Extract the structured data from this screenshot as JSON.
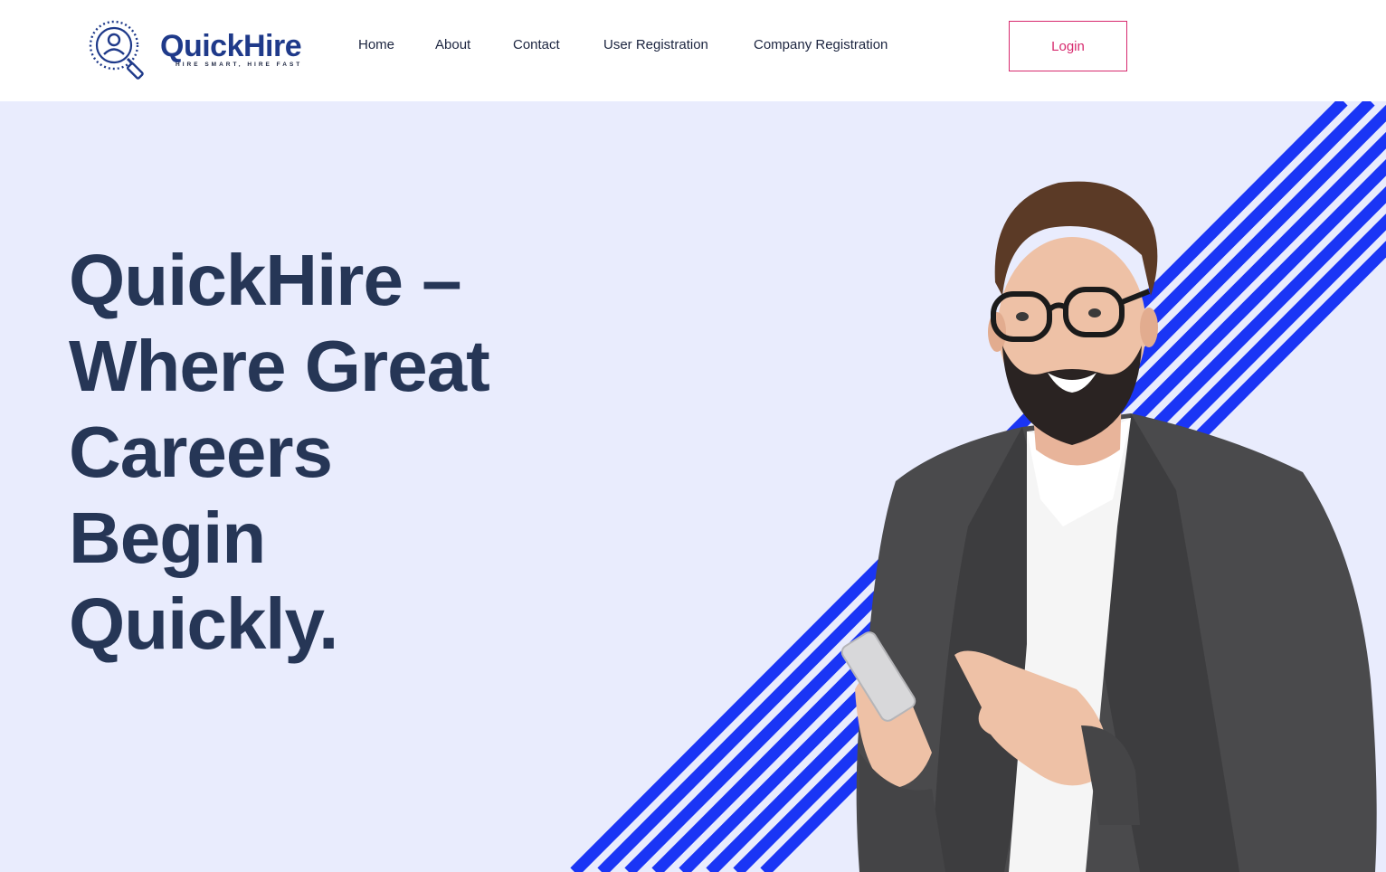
{
  "brand": {
    "name": "QuickHire",
    "tagline": "HIRE SMART, HIRE FAST",
    "logo_icon": "magnifier-user-icon",
    "color": "#1f3a8a"
  },
  "nav": {
    "items": [
      {
        "label": "Home"
      },
      {
        "label": "About"
      },
      {
        "label": "Contact"
      },
      {
        "label": "User Registration"
      },
      {
        "label": "Company Registration"
      }
    ],
    "login_label": "Login",
    "login_color": "#d72a6e"
  },
  "hero": {
    "title_lines": [
      "QuickHire –",
      "Where Great",
      "Careers",
      "Begin",
      "Quickly."
    ],
    "title_color": "#263656",
    "background": "#e9ecfd",
    "stripe_color": "#1a35f5",
    "image": "businessman-with-phone-photo"
  }
}
